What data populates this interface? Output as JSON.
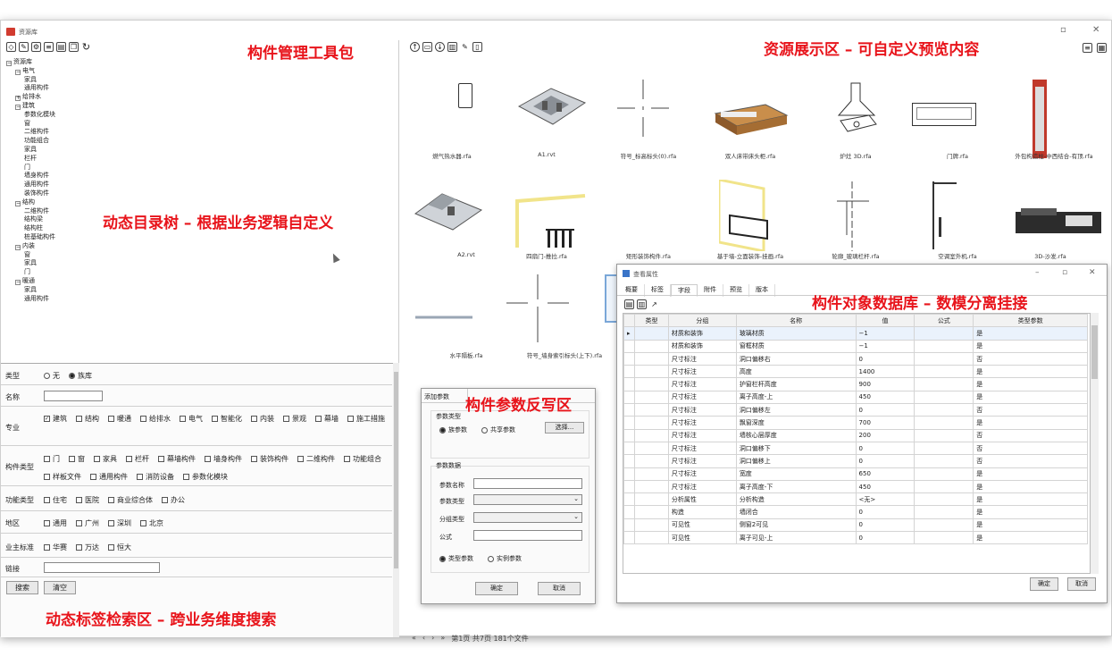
{
  "window": {
    "title": "资源库"
  },
  "annotations": {
    "tools": "构件管理工具包",
    "preview": "资源展示区 – 可自定义预览内容",
    "tree": "动态目录树 – 根据业务逻辑自定义",
    "search": "动态标签检索区 – 跨业务维度搜索",
    "db": "构件对象数据库 – 数模分离挂接",
    "param": "构件参数反写区"
  },
  "tree": [
    {
      "t": "资源库",
      "d": 0,
      "pm": "−"
    },
    {
      "t": "电气",
      "d": 1,
      "pm": "−"
    },
    {
      "t": "家具",
      "d": 2
    },
    {
      "t": "通用构件",
      "d": 2
    },
    {
      "t": "给排水",
      "d": 1,
      "pm": "+"
    },
    {
      "t": "建筑",
      "d": 1,
      "pm": "−"
    },
    {
      "t": "参数化模块",
      "d": 2
    },
    {
      "t": "窗",
      "d": 2
    },
    {
      "t": "二维构件",
      "d": 2
    },
    {
      "t": "功能组合",
      "d": 2
    },
    {
      "t": "家具",
      "d": 2
    },
    {
      "t": "栏杆",
      "d": 2
    },
    {
      "t": "门",
      "d": 2
    },
    {
      "t": "墙身构件",
      "d": 2
    },
    {
      "t": "通用构件",
      "d": 2
    },
    {
      "t": "装饰构件",
      "d": 2
    },
    {
      "t": "结构",
      "d": 1,
      "pm": "−"
    },
    {
      "t": "二维构件",
      "d": 2
    },
    {
      "t": "结构梁",
      "d": 2
    },
    {
      "t": "结构柱",
      "d": 2
    },
    {
      "t": "桩基础构件",
      "d": 2
    },
    {
      "t": "内装",
      "d": 1,
      "pm": "−"
    },
    {
      "t": "窗",
      "d": 2
    },
    {
      "t": "家具",
      "d": 2
    },
    {
      "t": "门",
      "d": 2
    },
    {
      "t": "暖通",
      "d": 1,
      "pm": "−"
    },
    {
      "t": "家具",
      "d": 2
    },
    {
      "t": "通用构件",
      "d": 2
    }
  ],
  "form": {
    "type_label": "类型",
    "type_opts": [
      "无",
      "族库"
    ],
    "name_label": "名称",
    "major_label": "专业",
    "major_opts": [
      "建筑",
      "结构",
      "暖通",
      "给排水",
      "电气",
      "智能化",
      "内装",
      "景观",
      "幕墙",
      "施工措施"
    ],
    "comp_label": "构件类型",
    "comp_opts": [
      "门",
      "窗",
      "家具",
      "栏杆",
      "幕墙构件",
      "墙身构件",
      "装饰构件",
      "二维构件",
      "功能组合",
      "样板文件",
      "通用构件",
      "消防设备",
      "参数化模块"
    ],
    "func_label": "功能类型",
    "func_opts": [
      "住宅",
      "医院",
      "商业综合体",
      "办公"
    ],
    "region_label": "地区",
    "region_opts": [
      "通用",
      "广州",
      "深圳",
      "北京"
    ],
    "std_label": "业主标准",
    "std_opts": [
      "华赛",
      "万达",
      "恒大"
    ],
    "link_label": "链接",
    "search_btn": "搜索",
    "clear_btn": "清空"
  },
  "thumbs": [
    "燃气热水器.rfa",
    "A1.rvt",
    "符号_标高标头(0).rfa",
    "双人床带床头柜.rfa",
    "炉灶 3D.rfa",
    "门牌.rfa",
    "外包构造柱-中西结合-有顶.rfa",
    "A2.rvt",
    "四扇门-推拉.rfa",
    "矩形装饰构件.rfa",
    "基于墙-立面装饰-挂画.rfa",
    "轮廓_玻璃栏杆.rfa",
    "空调室外机.rfa",
    "3D-沙发.rfa",
    "水平隔板.rfa",
    "符号_墙身索引标头(上下).rfa"
  ],
  "pager": {
    "first": "«",
    "prev": "‹",
    "next": "›",
    "last": "»",
    "info": "第1页 共7页 181个文件"
  },
  "param": {
    "tab": "添加参数",
    "ptype_label": "参数类型",
    "ptype_opts": [
      "族参数",
      "共享参数"
    ],
    "select_btn": "选择...",
    "pdata_label": "参数数据",
    "pname_label": "参数名称",
    "pkind_label": "参数类型",
    "group_label": "分组类型",
    "formula_label": "公式",
    "inst_opts": [
      "类型参数",
      "实例参数"
    ],
    "ok": "确定",
    "cancel": "取消"
  },
  "db": {
    "title": "查看属性",
    "tabs": [
      "概要",
      "标签",
      "字段",
      "附件",
      "预览",
      "版本"
    ],
    "headers": [
      "类型",
      "分组",
      "名称",
      "值",
      "公式",
      "类型参数"
    ],
    "rows": [
      [
        "材质和装饰",
        "玻璃材质",
        "−1",
        "",
        "是"
      ],
      [
        "材质和装饰",
        "窗框材质",
        "−1",
        "",
        "是"
      ],
      [
        "尺寸标注",
        "洞口偏移右",
        "0",
        "",
        "否"
      ],
      [
        "尺寸标注",
        "高度",
        "1400",
        "",
        "是"
      ],
      [
        "尺寸标注",
        "护窗栏杆高度",
        "900",
        "",
        "是"
      ],
      [
        "尺寸标注",
        "离子高度-上",
        "450",
        "",
        "是"
      ],
      [
        "尺寸标注",
        "洞口偏移左",
        "0",
        "",
        "否"
      ],
      [
        "尺寸标注",
        "飘窗深度",
        "700",
        "",
        "是"
      ],
      [
        "尺寸标注",
        "墙核心层厚度",
        "200",
        "",
        "否"
      ],
      [
        "尺寸标注",
        "洞口偏移下",
        "0",
        "",
        "否"
      ],
      [
        "尺寸标注",
        "洞口偏移上",
        "0",
        "",
        "否"
      ],
      [
        "尺寸标注",
        "宽度",
        "650",
        "",
        "是"
      ],
      [
        "尺寸标注",
        "离子高度-下",
        "450",
        "",
        "是"
      ],
      [
        "分析属性",
        "分析构造",
        "<无>",
        "",
        "是"
      ],
      [
        "构造",
        "墙闭合",
        "0",
        "",
        "是"
      ],
      [
        "可见性",
        "侧窗2可见",
        "0",
        "",
        "是"
      ],
      [
        "可见性",
        "离子可见-上",
        "0",
        "",
        "是"
      ]
    ],
    "ok": "确定",
    "cancel": "取消"
  }
}
